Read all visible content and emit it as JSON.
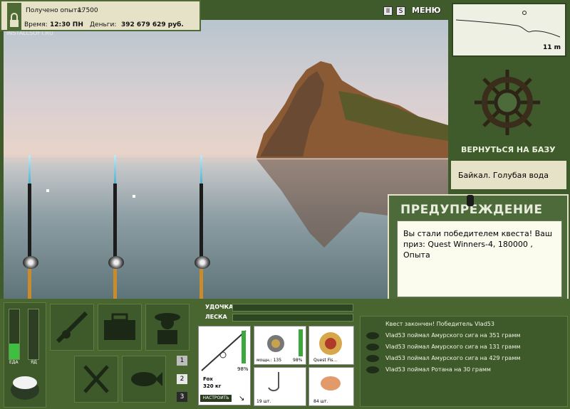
{
  "header": {
    "experience_label": "Получено опыта:",
    "experience_value": "17500",
    "time_label": "Время:",
    "time_value": "12:30 ПН",
    "money_label": "Деньги:",
    "money_value": "392 679 629 руб.",
    "watermark": "INSTALLSOFT.RU"
  },
  "top_buttons": {
    "pause": "II",
    "sound": "S",
    "menu": "МЕНЮ"
  },
  "sonar": {
    "depth": "11 m"
  },
  "base": {
    "return_label": "ВЕРНУТЬСЯ НА БАЗУ"
  },
  "location": {
    "name": "Байкал. Голубая вода"
  },
  "warning": {
    "title": "ПРЕДУПРЕЖДЕНИЕ",
    "message": "Вы стали победителем квеста! Ваш приз: Quest Winners-4, 180000 , Опыта"
  },
  "status_bars": {
    "food": "ЕДА",
    "poison": "ЯД"
  },
  "lines": {
    "rod": "УДОЧКА",
    "line": "ЛЕСКА"
  },
  "tackle": {
    "rod_name": "Fox",
    "rod_capacity": "320 кг",
    "rod_percent": "98%",
    "setup_button": "НАСТРОИТЬ",
    "reel_power": "мощн.: 135",
    "reel_percent": "98%",
    "line_name": "Quest Fis...",
    "hook_count": "19 шт.",
    "bait_count": "84 шт."
  },
  "pages": [
    "1",
    "2",
    "3"
  ],
  "log": [
    "Квест закончен! Победитель Vlad53",
    "Vlad53 поймал Амурского сига на 351 грамм",
    "Vlad53 поймал Амурского сига на 131 грамм",
    "Vlad53 поймал Амурского сига на 429 грамм",
    "Vlad53 поймал Ротана на 30 грамм"
  ]
}
